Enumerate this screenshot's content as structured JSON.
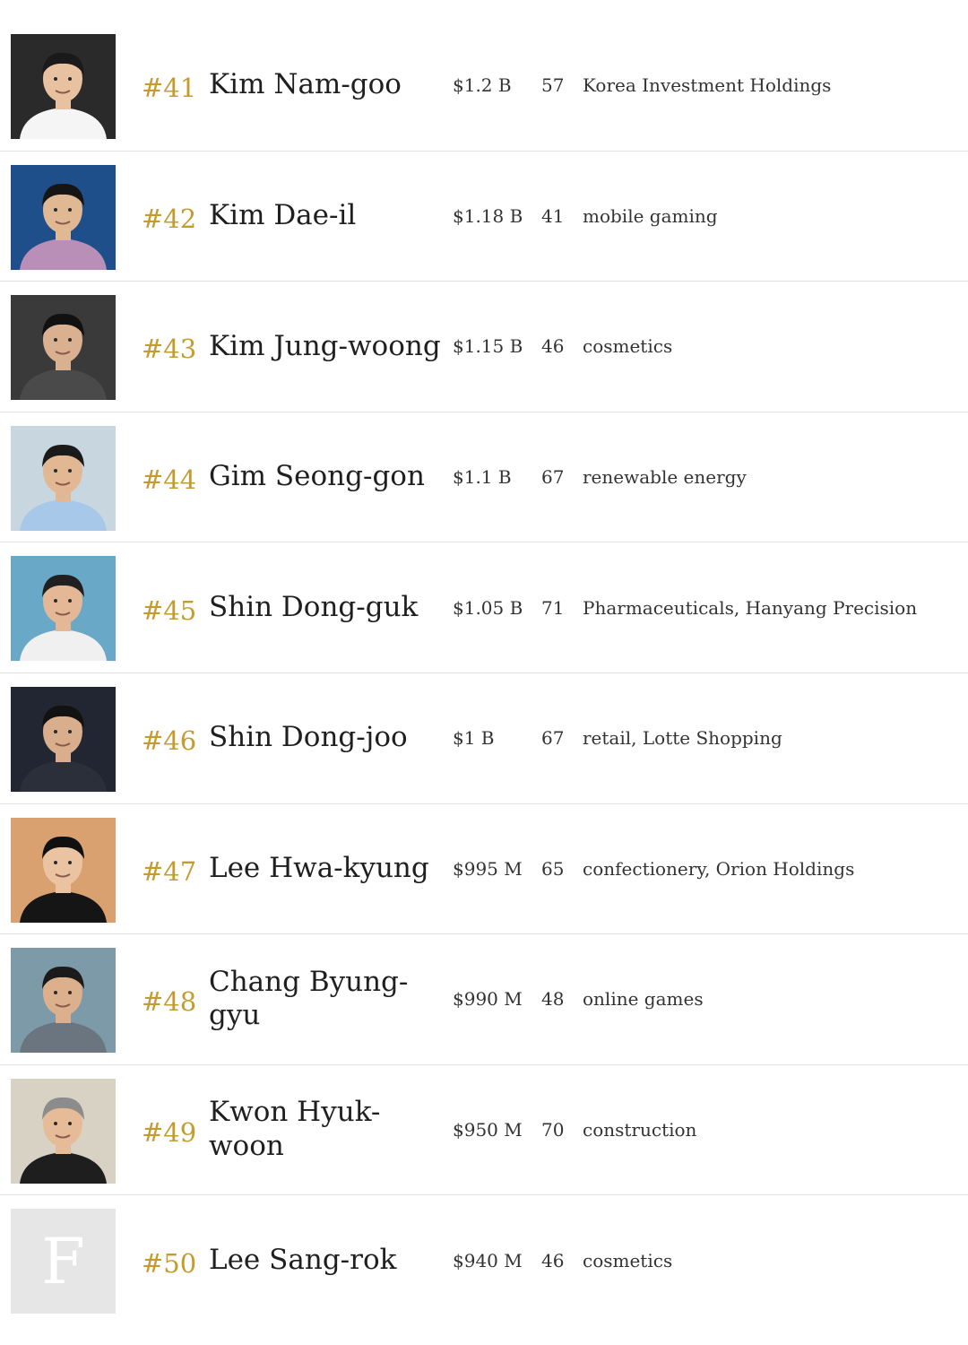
{
  "people": [
    {
      "rank": "#41",
      "name": "Kim Nam-goo",
      "net_worth": "$1.2 B",
      "age": "57",
      "source": "Korea Investment Holdings",
      "photo": {
        "bg": "#2a2a2a",
        "skin": "#e8c2a0",
        "shirt": "#f5f5f5",
        "hair": "#1a1a1a"
      }
    },
    {
      "rank": "#42",
      "name": "Kim Dae-il",
      "net_worth": "$1.18 B",
      "age": "41",
      "source": "mobile gaming",
      "photo": {
        "bg": "#1f4f8a",
        "skin": "#e0b894",
        "shirt": "#b98fb8",
        "hair": "#151515"
      }
    },
    {
      "rank": "#43",
      "name": "Kim Jung-woong",
      "net_worth": "$1.15 B",
      "age": "46",
      "source": "cosmetics",
      "photo": {
        "bg": "#3a3a3a",
        "skin": "#d9b090",
        "shirt": "#4a4a4a",
        "hair": "#111111"
      }
    },
    {
      "rank": "#44",
      "name": "Gim Seong-gon",
      "net_worth": "$1.1 B",
      "age": "67",
      "source": "renewable energy",
      "photo": {
        "bg": "#c8d6e0",
        "skin": "#e2b793",
        "shirt": "#a8c8ea",
        "hair": "#1a1a1a"
      }
    },
    {
      "rank": "#45",
      "name": "Shin Dong-guk",
      "net_worth": "$1.05 B",
      "age": "71",
      "source": "Pharmaceuticals, Hanyang Precision",
      "photo": {
        "bg": "#6aa8c8",
        "skin": "#e4b896",
        "shirt": "#f0f0f0",
        "hair": "#202020"
      }
    },
    {
      "rank": "#46",
      "name": "Shin Dong-joo",
      "net_worth": "$1 B",
      "age": "67",
      "source": "retail, Lotte Shopping",
      "photo": {
        "bg": "#222633",
        "skin": "#d8ae8c",
        "shirt": "#2b2f3a",
        "hair": "#121212"
      }
    },
    {
      "rank": "#47",
      "name": "Lee Hwa-kyung",
      "net_worth": "$995 M",
      "age": "65",
      "source": "confectionery, Orion Holdings",
      "photo": {
        "bg": "#d9a070",
        "skin": "#eac4a2",
        "shirt": "#151515",
        "hair": "#101010"
      }
    },
    {
      "rank": "#48",
      "name": "Chang Byung-gyu",
      "net_worth": "$990 M",
      "age": "48",
      "source": "online games",
      "photo": {
        "bg": "#7d9aa8",
        "skin": "#dcb08c",
        "shirt": "#6a7580",
        "hair": "#1b1b1b"
      }
    },
    {
      "rank": "#49",
      "name": "Kwon Hyuk-woon",
      "net_worth": "$950 M",
      "age": "70",
      "source": "construction",
      "photo": {
        "bg": "#d8d2c4",
        "skin": "#e6bb98",
        "shirt": "#1e1e1e",
        "hair": "#8c8c8c"
      }
    },
    {
      "rank": "#50",
      "name": "Lee Sang-rok",
      "net_worth": "$940 M",
      "age": "46",
      "source": "cosmetics",
      "photo": {
        "placeholder": "F"
      }
    }
  ]
}
